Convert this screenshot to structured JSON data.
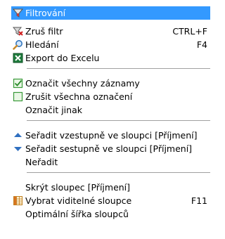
{
  "menu": {
    "items": [
      {
        "label": "Filtrování",
        "icon": "funnel-icon"
      },
      {
        "label": "Zruš filtr",
        "shortcut": "CTRL+F",
        "icon": "funnel-remove-icon"
      },
      {
        "label": "Hledání",
        "shortcut": "F4",
        "icon": "magnifier-icon"
      },
      {
        "label": "Export do Excelu",
        "icon": "excel-icon"
      },
      {
        "label": "Označit všechny záznamy",
        "icon": "check-all-icon"
      },
      {
        "label": "Zrušit všechna označení",
        "icon": "uncheck-all-icon"
      },
      {
        "label": "Označit jinak"
      },
      {
        "label": "Seřadit vzestupně ve sloupci [Příjmení]",
        "icon": "sort-ascending-icon"
      },
      {
        "label": "Seřadit sestupně ve sloupci [Příjmení]",
        "icon": "sort-descending-icon"
      },
      {
        "label": "Neřadit"
      },
      {
        "label": "Skrýt sloupec [Příjmení]"
      },
      {
        "label": "Vybrat viditelné sloupce",
        "shortcut": "F11",
        "icon": "columns-icon"
      },
      {
        "label": "Optimální šířka sloupců"
      }
    ]
  },
  "colors": {
    "highlight": "#3399ff",
    "separator": "#a0a0a0"
  }
}
